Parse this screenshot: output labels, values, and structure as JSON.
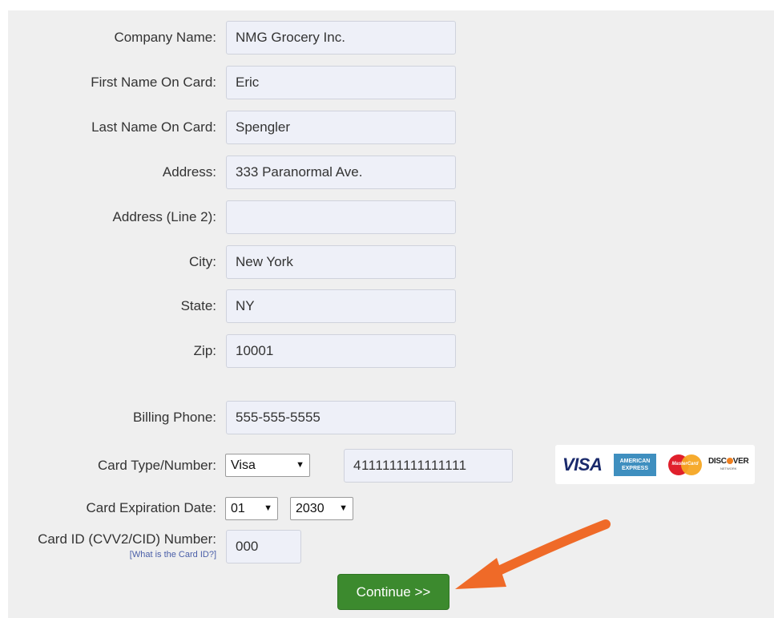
{
  "form": {
    "company_name": {
      "label": "Company Name:",
      "value": "NMG Grocery Inc."
    },
    "first_name": {
      "label": "First Name On Card:",
      "value": "Eric"
    },
    "last_name": {
      "label": "Last Name On Card:",
      "value": "Spengler"
    },
    "address": {
      "label": "Address:",
      "value": "333 Paranormal Ave."
    },
    "address2": {
      "label": "Address (Line 2):",
      "value": ""
    },
    "city": {
      "label": "City:",
      "value": "New York"
    },
    "state": {
      "label": "State:",
      "value": "NY"
    },
    "zip": {
      "label": "Zip:",
      "value": "10001"
    },
    "billing_phone": {
      "label": "Billing Phone:",
      "value": "555-555-5555"
    },
    "card_type_number": {
      "label": "Card Type/Number:",
      "card_type": "Visa",
      "card_number": "4111111111111111"
    },
    "card_expiration": {
      "label": "Card Expiration Date:",
      "month": "01",
      "year": "2030"
    },
    "card_id": {
      "label": "Card ID (CVV2/CID) Number:",
      "help_link": "What is the Card ID?",
      "value": "000"
    }
  },
  "card_logos": {
    "visa": "VISA",
    "amex_line1": "AMERICAN",
    "amex_line2": "EXPRESS",
    "mastercard": "MasterCard",
    "discover_left": "DISC",
    "discover_right": "VER",
    "discover_sub": "NETWORK"
  },
  "continue_button": "Continue >>",
  "colors": {
    "panel_bg": "#efefef",
    "field_bg": "#eef0f8",
    "button_green": "#3c8a2e",
    "arrow_orange": "#ef6a28"
  }
}
